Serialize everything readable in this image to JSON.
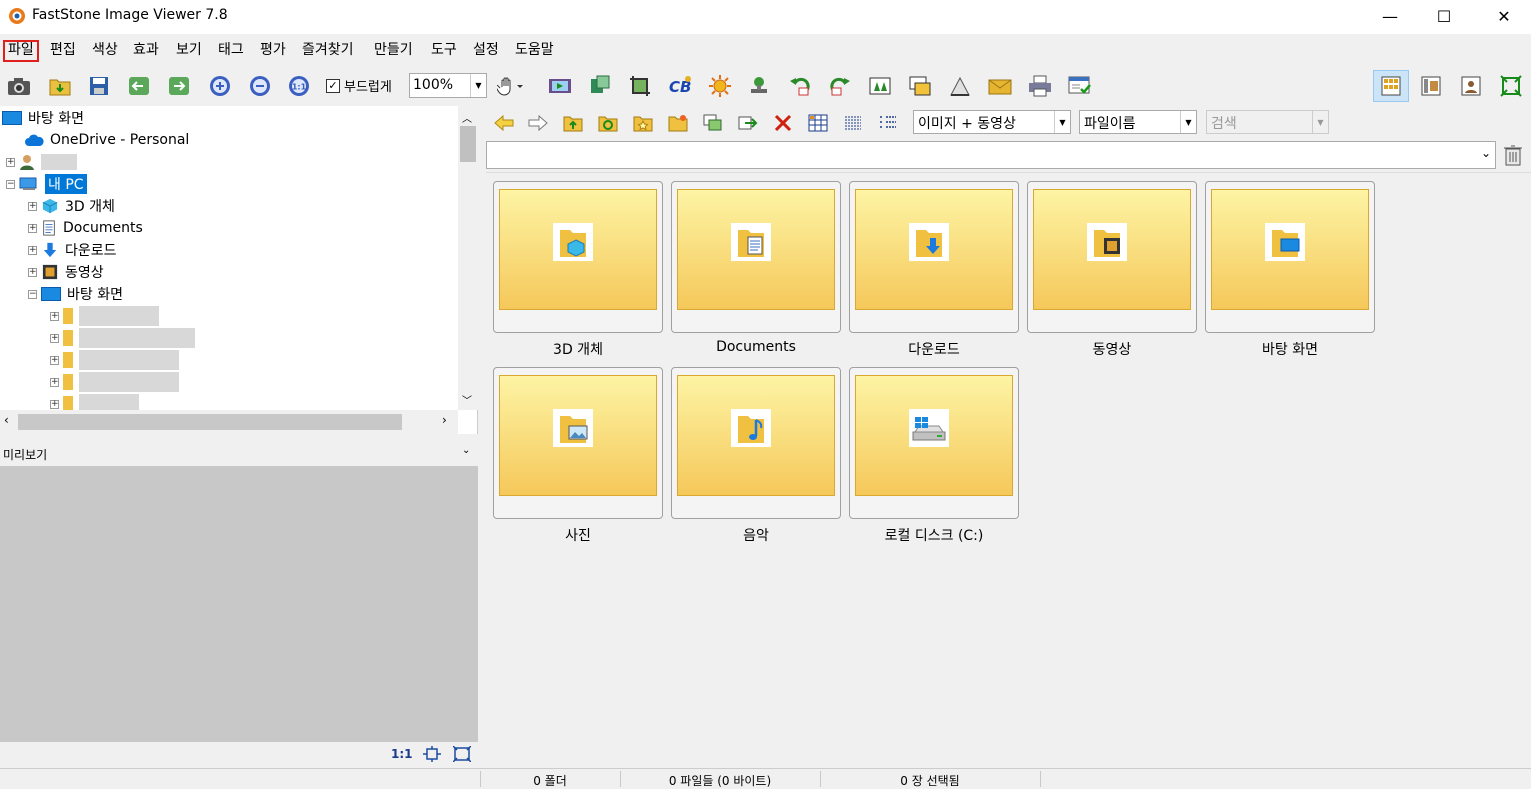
{
  "window": {
    "title": "FastStone Image Viewer 7.8"
  },
  "menu": [
    "파일",
    "편집",
    "색상",
    "효과",
    "보기",
    "태그",
    "평가",
    "즐겨찾기",
    "만들기",
    "도구",
    "설정",
    "도움말"
  ],
  "toolbar": {
    "smooth_label": "부드럽게",
    "zoom_value": "100%"
  },
  "tree": {
    "desktop": "바탕 화면",
    "onedrive": "OneDrive - Personal",
    "mypc": "내 PC",
    "objects3d": "3D 개체",
    "documents": "Documents",
    "downloads": "다운로드",
    "videos": "동영상",
    "desktop2": "바탕 화면"
  },
  "preview": {
    "title": "미리보기",
    "ratio": "1:1"
  },
  "filters": {
    "type": "이미지 + 동영상",
    "sort": "파일이름",
    "search": "검색"
  },
  "folders": [
    "3D 개체",
    "Documents",
    "다운로드",
    "동영상",
    "바탕 화면",
    "사진",
    "음악",
    "로컬 디스크 (C:)"
  ],
  "status": {
    "folders": "0 폴더",
    "files": "0 파일들 (0 바이트)",
    "selected": "0 장 선택됨"
  },
  "colors": {
    "selection": "#0078d7",
    "folder_top": "#fdf4a4",
    "folder_bottom": "#f5c85a",
    "menu_highlight": "#e0201c"
  }
}
